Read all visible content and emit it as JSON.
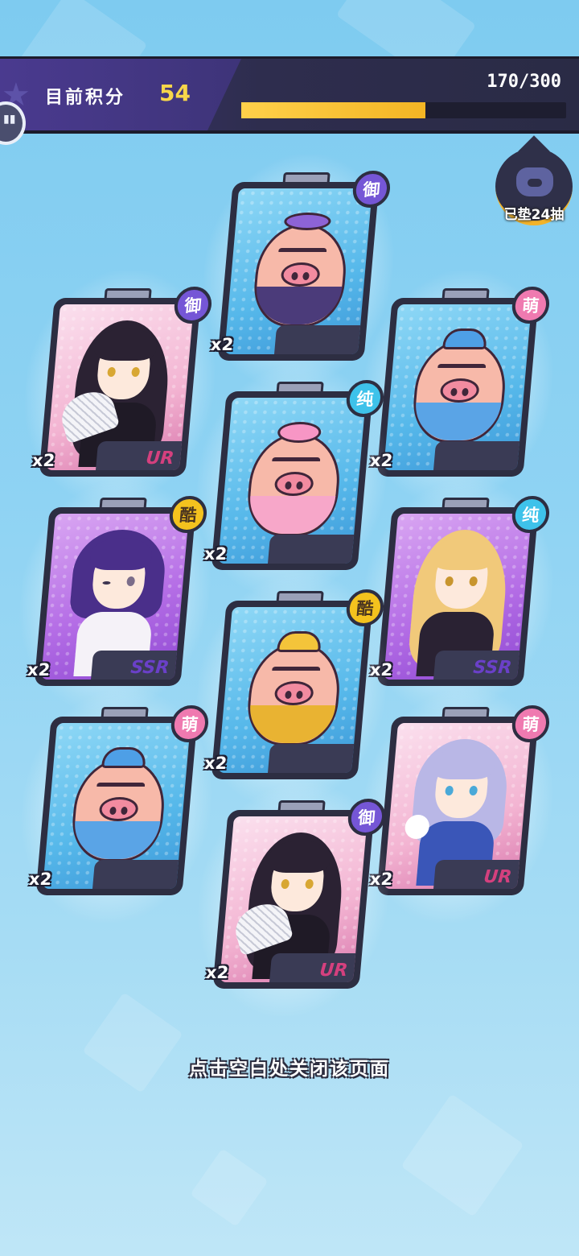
{
  "header": {
    "score_label": "目前积分",
    "score_value": "54",
    "progress_text": "170/300",
    "progress_fraction": 0.567
  },
  "pity_badge": {
    "text": "已垫24抽",
    "icon": "pig-icon"
  },
  "cards": [
    {
      "id": "c1",
      "kind": "pig",
      "outfit": "suit",
      "attr": "御",
      "count": "x2",
      "rarity": ""
    },
    {
      "id": "c2",
      "kind": "girl",
      "style": "kimono-fan",
      "attr": "御",
      "count": "x2",
      "rarity": "UR"
    },
    {
      "id": "c3",
      "kind": "pig",
      "outfit": "denim",
      "attr": "萌",
      "count": "x2",
      "rarity": ""
    },
    {
      "id": "c4",
      "kind": "pig",
      "outfit": "bow",
      "attr": "纯",
      "count": "x2",
      "rarity": ""
    },
    {
      "id": "c5",
      "kind": "girl",
      "style": "purple-hair",
      "attr": "酷",
      "count": "x2",
      "rarity": "SSR"
    },
    {
      "id": "c6",
      "kind": "girl",
      "style": "maid-blonde",
      "attr": "纯",
      "count": "x2",
      "rarity": "SSR"
    },
    {
      "id": "c7",
      "kind": "pig",
      "outfit": "gold",
      "attr": "酷",
      "count": "x2",
      "rarity": ""
    },
    {
      "id": "c8",
      "kind": "pig",
      "outfit": "denim",
      "attr": "萌",
      "count": "x2",
      "rarity": ""
    },
    {
      "id": "c9",
      "kind": "girl",
      "style": "sailor-lilac",
      "attr": "萌",
      "count": "x2",
      "rarity": "UR"
    },
    {
      "id": "c10",
      "kind": "girl",
      "style": "kimono-fan",
      "attr": "御",
      "count": "x2",
      "rarity": "UR"
    }
  ],
  "footer": {
    "hint": "点击空白处关闭该页面"
  }
}
